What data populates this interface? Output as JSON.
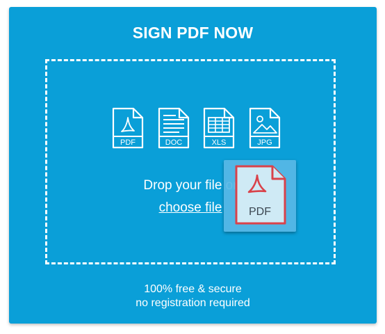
{
  "card": {
    "title": "SIGN PDF NOW",
    "background_color": "#0a9fd8"
  },
  "dropzone": {
    "formats": [
      {
        "label": "PDF",
        "icon": "pdf-file-icon"
      },
      {
        "label": "DOC",
        "icon": "doc-file-icon"
      },
      {
        "label": "XLS",
        "icon": "xls-file-icon"
      },
      {
        "label": "JPG",
        "icon": "jpg-file-icon"
      }
    ],
    "drop_text": "Drop your file or",
    "choose_link": "choose file"
  },
  "drag_preview": {
    "label": "PDF",
    "icon": "acrobat-pdf-icon",
    "accent_color": "#d9424a"
  },
  "footer": {
    "line1": "100% free & secure",
    "line2": "no registration required"
  }
}
